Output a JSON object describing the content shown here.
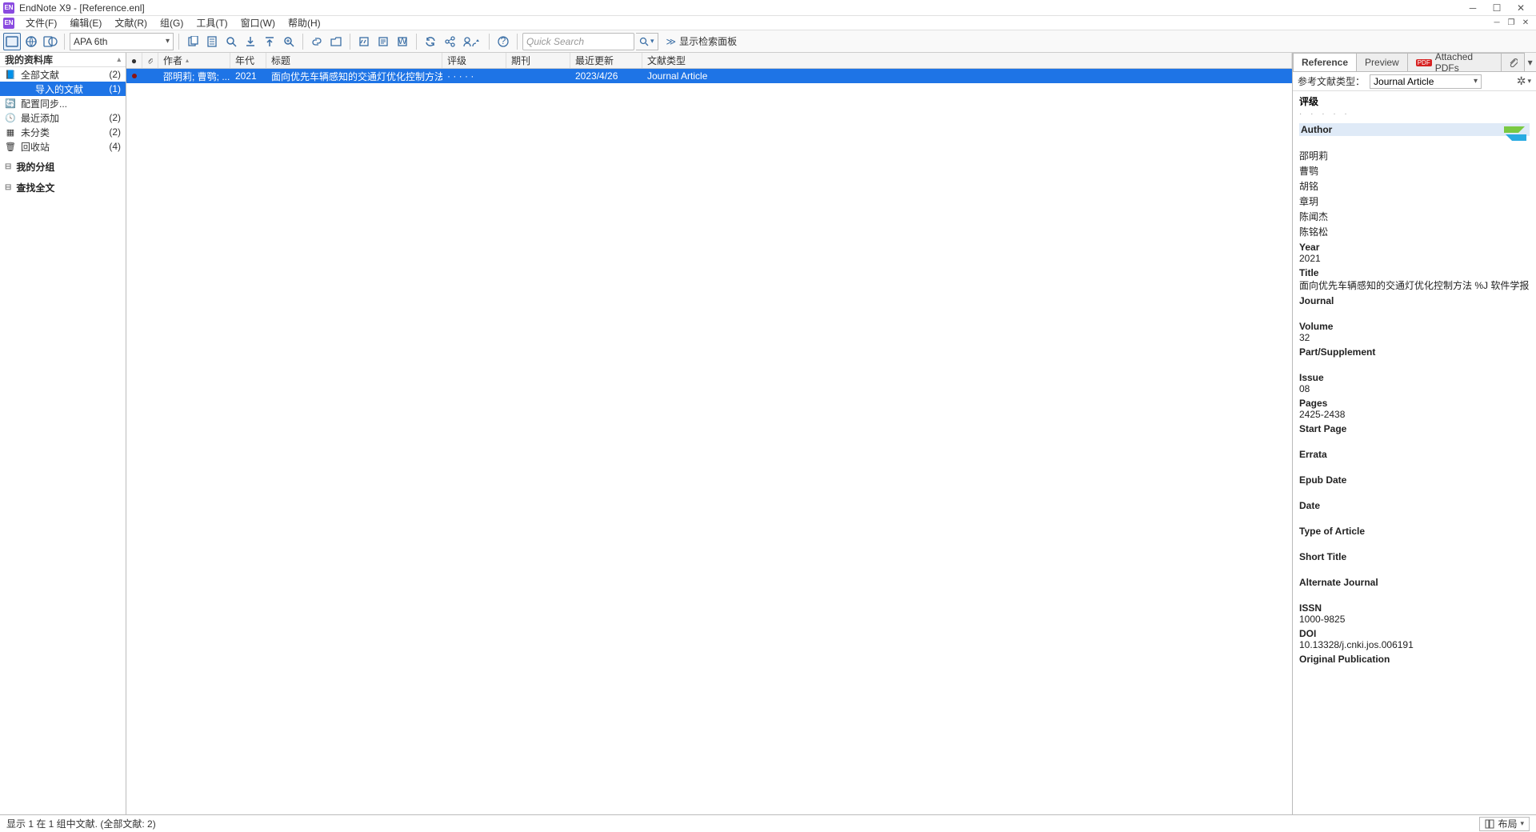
{
  "window": {
    "title": "EndNote X9 - [Reference.enl]"
  },
  "menu": [
    "文件(F)",
    "编辑(E)",
    "文献(R)",
    "组(G)",
    "工具(T)",
    "窗口(W)",
    "帮助(H)"
  ],
  "toolbar": {
    "style": "APA 6th",
    "quick_search_placeholder": "Quick Search",
    "show_search_panel": "显示检索面板"
  },
  "sidebar": {
    "header": "我的资料库",
    "items": [
      {
        "icon": "📘",
        "icon_name": "library-icon",
        "label": "全部文献",
        "count": "(2)",
        "selected": false,
        "indent": false
      },
      {
        "icon": "",
        "icon_name": "imported-icon",
        "label": "导入的文献",
        "count": "(1)",
        "selected": true,
        "indent": true
      },
      {
        "icon": "🔄",
        "icon_name": "sync-icon",
        "label": "配置同步...",
        "count": "",
        "selected": false,
        "indent": false
      },
      {
        "icon": "🕓",
        "icon_name": "recent-icon",
        "label": "最近添加",
        "count": "(2)",
        "selected": false,
        "indent": false
      },
      {
        "icon": "▦",
        "icon_name": "unfiled-icon",
        "label": "未分类",
        "count": "(2)",
        "selected": false,
        "indent": false
      },
      {
        "icon": "🗑",
        "icon_name": "trash-icon",
        "label": "回收站",
        "count": "(4)",
        "selected": false,
        "indent": false
      }
    ],
    "groups": [
      "我的分组",
      "查找全文"
    ]
  },
  "columns": {
    "author": "作者",
    "year": "年代",
    "title": "标题",
    "rating": "评级",
    "journal": "期刊",
    "updated": "最近更新",
    "type": "文献类型"
  },
  "rows": [
    {
      "author": "邵明莉; 曹鹗; ...",
      "year": "2021",
      "title": "面向优先车辆感知的交通灯优化控制方法 …",
      "rating": "· · · · ·",
      "journal": "",
      "updated": "2023/4/26",
      "type": "Journal Article",
      "selected": true
    }
  ],
  "rightpanel": {
    "tabs": {
      "reference": "Reference",
      "preview": "Preview",
      "pdfs": "Attached PDFs"
    },
    "reftype_label": "参考文献类型：",
    "reftype_value": "Journal Article",
    "rating_label": "评级",
    "fields": [
      {
        "label": "Author",
        "value": "",
        "active": true
      },
      {
        "label": "",
        "value": "邵明莉"
      },
      {
        "label": "",
        "value": "曹鹗"
      },
      {
        "label": "",
        "value": "胡铭"
      },
      {
        "label": "",
        "value": "章玥"
      },
      {
        "label": "",
        "value": "陈闻杰"
      },
      {
        "label": "",
        "value": "陈铭松"
      },
      {
        "label": "Year",
        "value": "2021"
      },
      {
        "label": "Title",
        "value": "面向优先车辆感知的交通灯优化控制方法 %J 软件学报"
      },
      {
        "label": "Journal",
        "value": ""
      },
      {
        "label": "Volume",
        "value": "32"
      },
      {
        "label": "Part/Supplement",
        "value": ""
      },
      {
        "label": "Issue",
        "value": "08"
      },
      {
        "label": "Pages",
        "value": "2425-2438"
      },
      {
        "label": "Start Page",
        "value": ""
      },
      {
        "label": "Errata",
        "value": ""
      },
      {
        "label": "Epub Date",
        "value": ""
      },
      {
        "label": "Date",
        "value": ""
      },
      {
        "label": "Type of Article",
        "value": ""
      },
      {
        "label": "Short Title",
        "value": ""
      },
      {
        "label": "Alternate Journal",
        "value": ""
      },
      {
        "label": "ISSN",
        "value": "1000-9825"
      },
      {
        "label": "DOI",
        "value": "10.13328/j.cnki.jos.006191"
      },
      {
        "label": "Original Publication",
        "value": ""
      }
    ]
  },
  "statusbar": {
    "text": "显示 1 在 1 组中文献. (全部文献: 2)",
    "layout": "布局"
  }
}
